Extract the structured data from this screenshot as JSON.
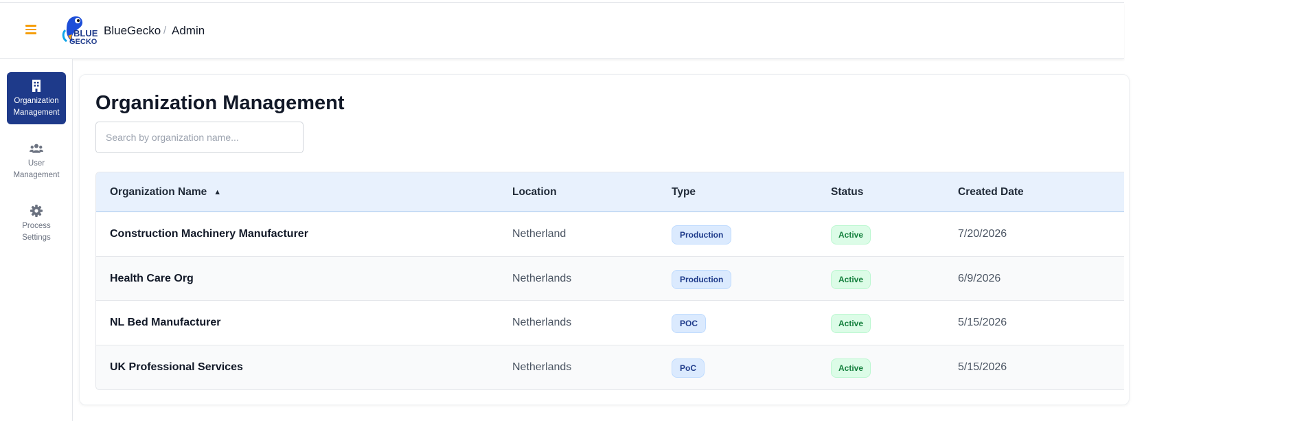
{
  "header": {
    "brand": "BlueGecko",
    "breadcrumb_sep": "/",
    "breadcrumb_page": "Admin",
    "logo_text": "BLUE GECKO",
    "menu_icon": "hamburger-icon",
    "accent_color": "#f59e0b"
  },
  "sidebar": {
    "items": [
      {
        "label_line1": "Organization",
        "label_line2": "Management",
        "icon": "building-icon",
        "active": true
      },
      {
        "label_line1": "User",
        "label_line2": "Management",
        "icon": "users-icon",
        "active": false
      },
      {
        "label_line1": "Process",
        "label_line2": "Settings",
        "icon": "gear-icon",
        "active": false
      }
    ],
    "active_color": "#1e3a8a"
  },
  "main": {
    "title": "Organization Management",
    "search": {
      "placeholder": "Search by organization name...",
      "value": ""
    },
    "table": {
      "columns": [
        "Organization Name",
        "Location",
        "Type",
        "Status",
        "Created Date"
      ],
      "sort": {
        "column": "Organization Name",
        "direction": "ascending",
        "indicator": "▲"
      },
      "rows": [
        {
          "name": "Construction Machinery Manufacturer",
          "location": "Netherland",
          "type": "Production",
          "status": "Active",
          "created": "7/20/2026"
        },
        {
          "name": "Health Care Org",
          "location": "Netherlands",
          "type": "Production",
          "status": "Active",
          "created": "6/9/2026"
        },
        {
          "name": "NL Bed Manufacturer",
          "location": "Netherlands",
          "type": "POC",
          "status": "Active",
          "created": "5/15/2026"
        },
        {
          "name": "UK Professional Services",
          "location": "Netherlands",
          "type": "PoC",
          "status": "Active",
          "created": "5/15/2026"
        }
      ]
    }
  }
}
